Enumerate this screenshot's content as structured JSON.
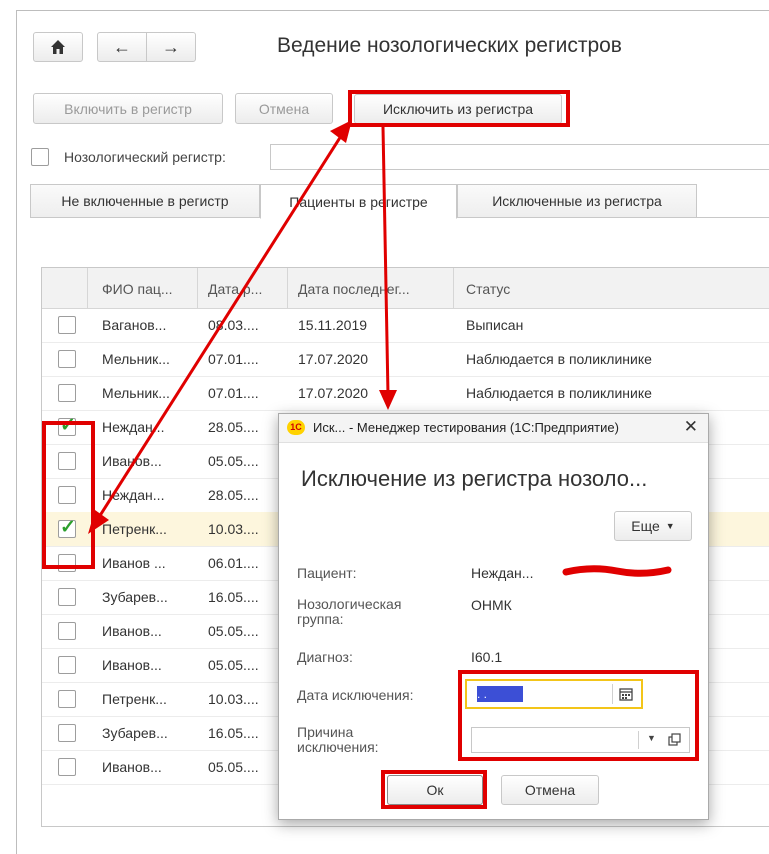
{
  "header": {
    "title": "Ведение нозологических регистров"
  },
  "toolbar": {
    "include_label": "Включить в регистр",
    "cancel_label": "Отмена",
    "exclude_label": "Исключить из регистра"
  },
  "filter": {
    "label": "Нозологический регистр:",
    "value": ""
  },
  "tabs": [
    {
      "label": "Не включенные в регистр"
    },
    {
      "label": "Пациенты в регистре"
    },
    {
      "label": "Исключенные из регистра"
    }
  ],
  "table": {
    "columns": [
      "ФИО пац...",
      "Дата р...",
      "Дата последнег...",
      "Статус"
    ],
    "rows": [
      {
        "name": "Ваганов...",
        "birth": "08.03....",
        "last": "15.11.2019",
        "status": "Выписан",
        "checked": false
      },
      {
        "name": "Мельник...",
        "birth": "07.01....",
        "last": "17.07.2020",
        "status": "Наблюдается в поликлинике",
        "checked": false
      },
      {
        "name": "Мельник...",
        "birth": "07.01....",
        "last": "17.07.2020",
        "status": "Наблюдается в поликлинике",
        "checked": false
      },
      {
        "name": "Неждан...",
        "birth": "28.05....",
        "last": "",
        "status": "",
        "checked": true
      },
      {
        "name": "Иванов...",
        "birth": "05.05....",
        "last": "",
        "status": "",
        "checked": false
      },
      {
        "name": "Неждан...",
        "birth": "28.05....",
        "last": "",
        "status": "",
        "checked": false
      },
      {
        "name": "Петренк...",
        "birth": "10.03....",
        "last": "",
        "status": "",
        "checked": true
      },
      {
        "name": "Иванов ...",
        "birth": "06.01....",
        "last": "",
        "status": "",
        "checked": false
      },
      {
        "name": "Зубарев...",
        "birth": "16.05....",
        "last": "",
        "status": "",
        "checked": false
      },
      {
        "name": "Иванов...",
        "birth": "05.05....",
        "last": "",
        "status": "",
        "checked": false
      },
      {
        "name": "Иванов...",
        "birth": "05.05....",
        "last": "",
        "status": "",
        "checked": false
      },
      {
        "name": "Петренк...",
        "birth": "10.03....",
        "last": "",
        "status": "",
        "checked": false
      },
      {
        "name": "Зубарев...",
        "birth": "16.05....",
        "last": "",
        "status": "",
        "checked": false
      },
      {
        "name": "Иванов...",
        "birth": "05.05....",
        "last": "",
        "status": "",
        "checked": false
      }
    ]
  },
  "dialog": {
    "window_title": "Иск...  - Менеджер тестирования (1С:Предприятие)",
    "logo": "1С",
    "heading": "Исключение из регистра нозоло...",
    "more_label": "Еще",
    "patient_label": "Пациент:",
    "patient_value": "Неждан...",
    "group_label": "Нозологическая группа:",
    "group_value": "ОНМК",
    "diagnosis_label": "Диагноз:",
    "diagnosis_value": "I60.1",
    "date_label": "Дата исключения:",
    "date_value": " .  . ",
    "reason_label": "Причина исключения:",
    "reason_value": "",
    "ok_label": "Ок",
    "cancel_label": "Отмена"
  },
  "colors": {
    "highlight": "#e00000",
    "check": "#2c9f2c",
    "selected_row": "#fdf6dd",
    "focus": "#f3c519"
  }
}
